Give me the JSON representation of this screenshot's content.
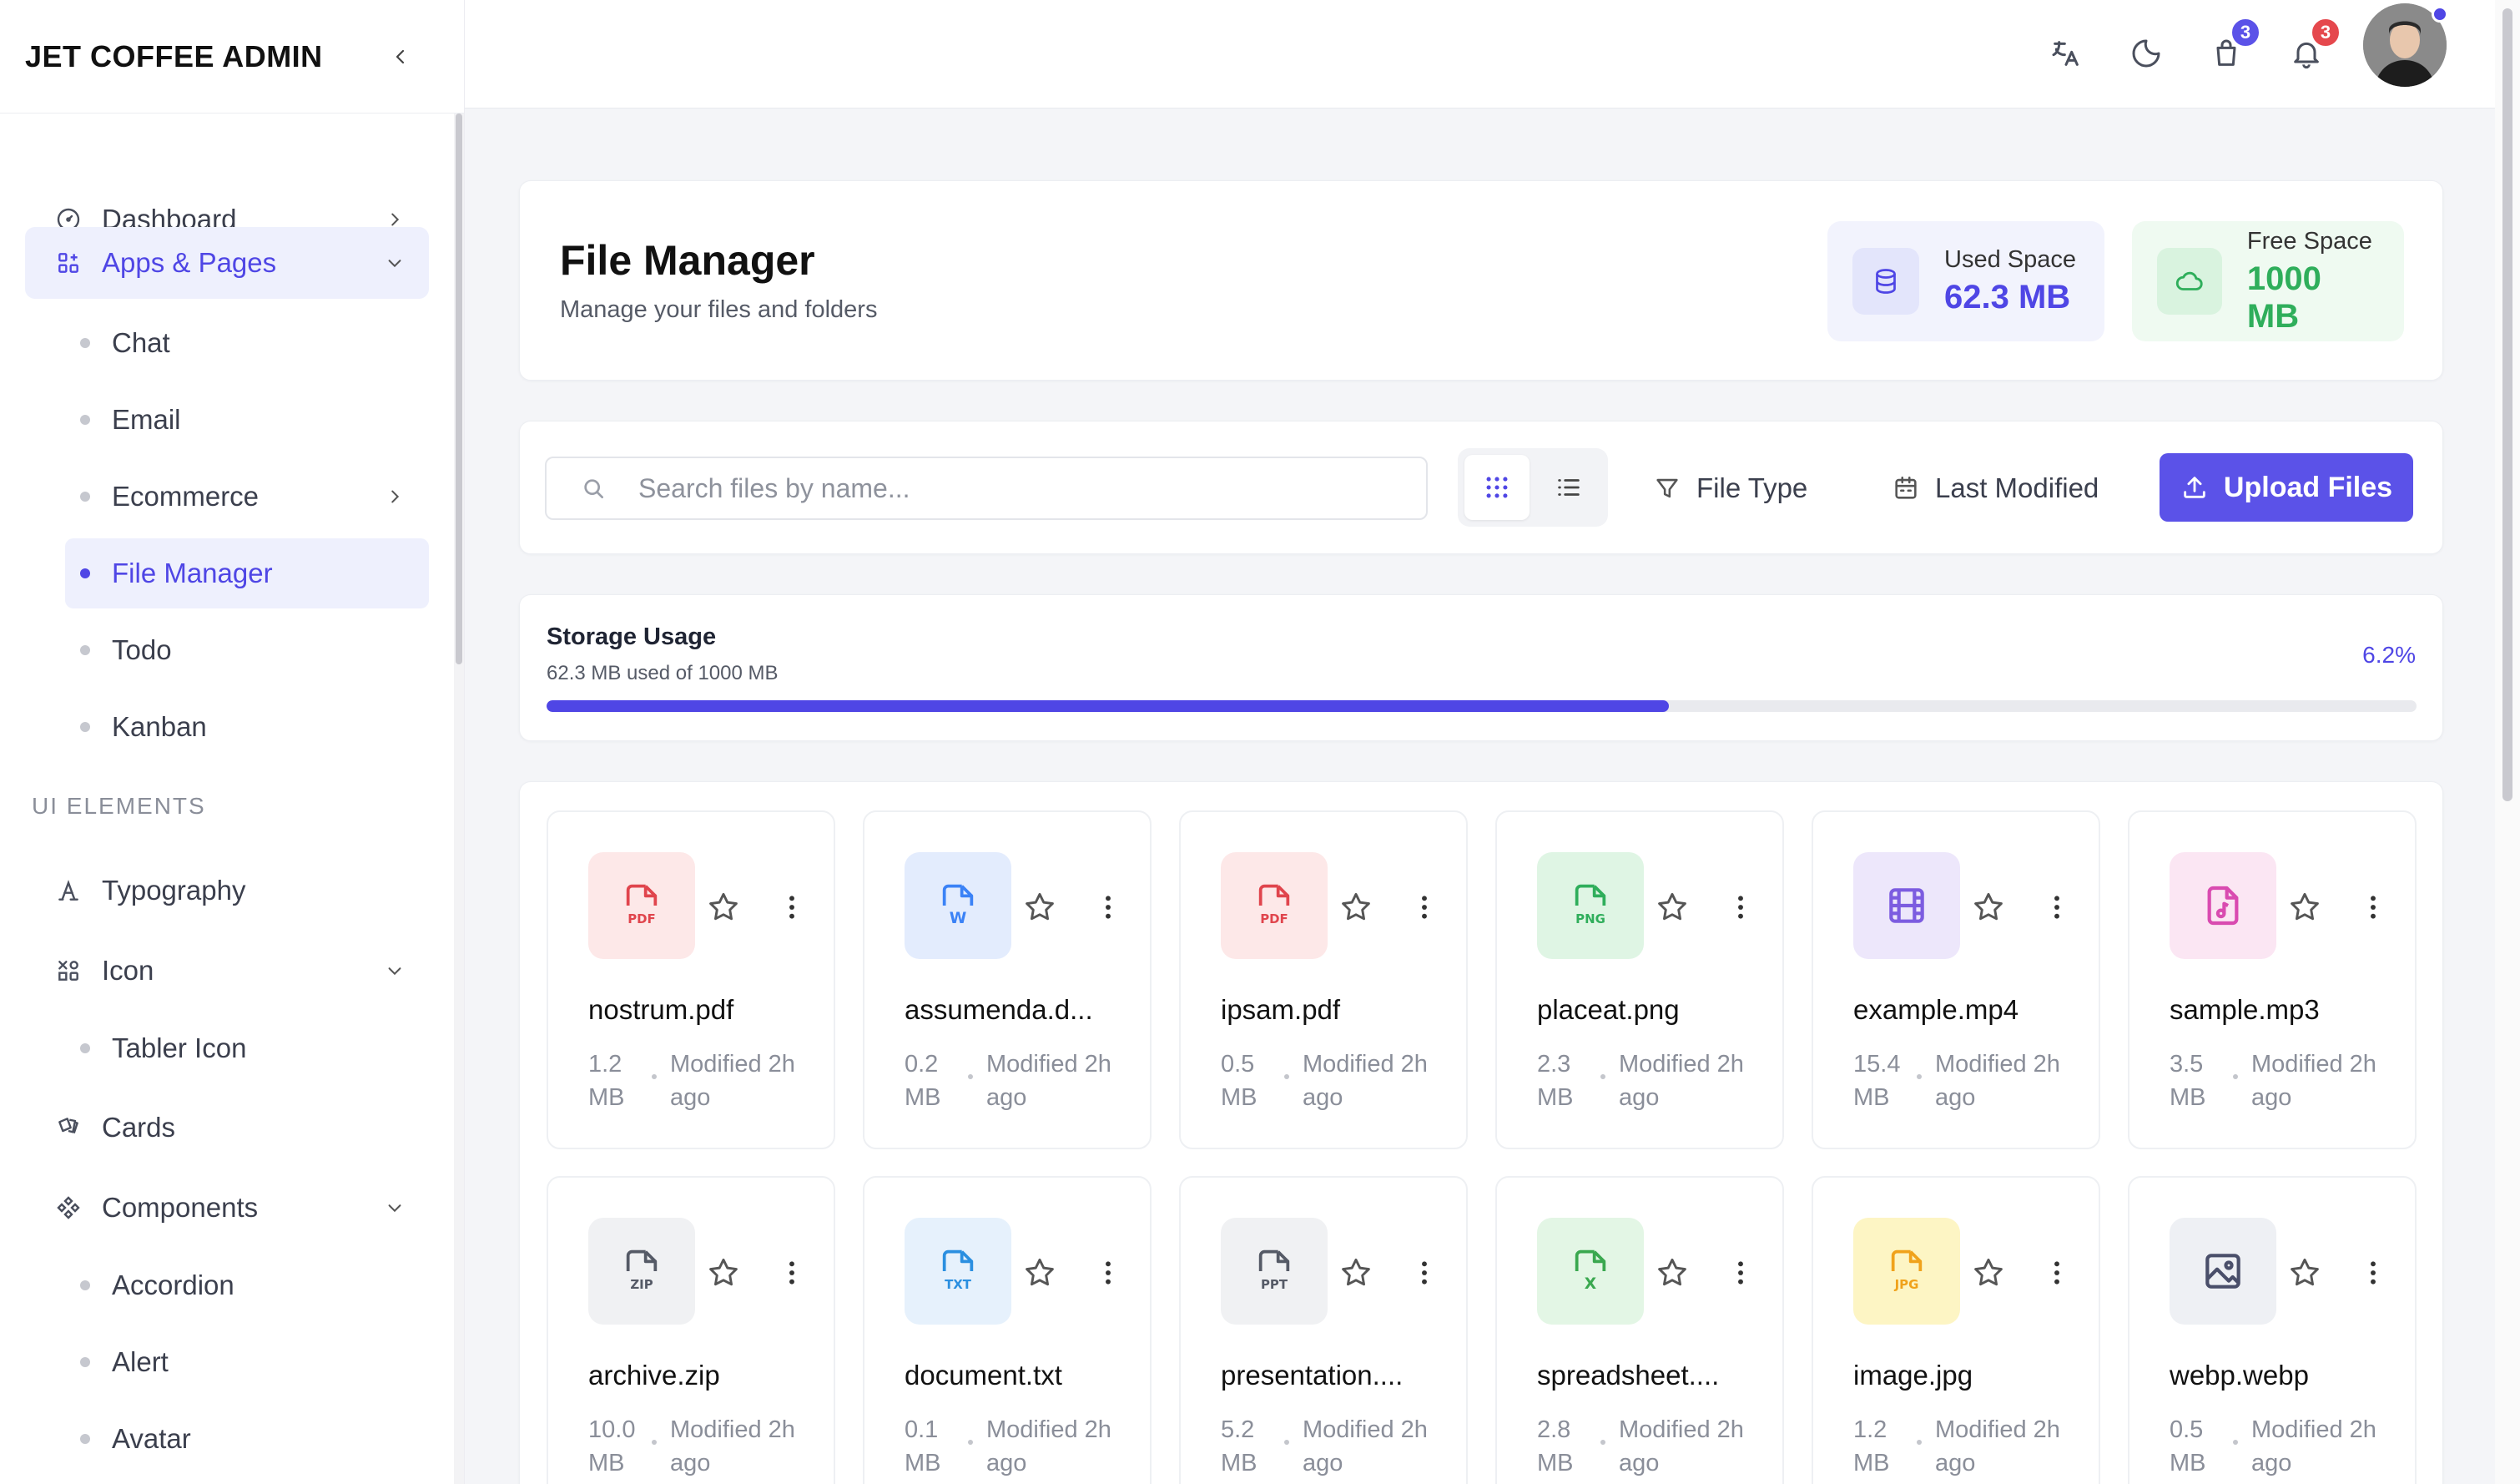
{
  "app": {
    "brand": "JET COFFEE ADMIN"
  },
  "sidebar": {
    "items": [
      {
        "label": "Dashboard"
      },
      {
        "label": "Apps & Pages"
      },
      {
        "label": "Chat"
      },
      {
        "label": "Email"
      },
      {
        "label": "Ecommerce"
      },
      {
        "label": "File Manager"
      },
      {
        "label": "Todo"
      },
      {
        "label": "Kanban"
      },
      {
        "label": "Typography"
      },
      {
        "label": "Icon"
      },
      {
        "label": "Tabler Icon"
      },
      {
        "label": "Cards"
      },
      {
        "label": "Components"
      },
      {
        "label": "Accordion"
      },
      {
        "label": "Alert"
      },
      {
        "label": "Avatar"
      }
    ],
    "section_ui": "UI ELEMENTS"
  },
  "header": {
    "cart_count": "3",
    "notif_count": "3"
  },
  "page": {
    "title": "File Manager",
    "subtitle": "Manage your files and folders",
    "used_label": "Used Space",
    "used_value": "62.3 MB",
    "free_label": "Free Space",
    "free_value": "1000 MB"
  },
  "toolbar": {
    "search_placeholder": "Search files by name...",
    "file_type": "File Type",
    "last_modified": "Last Modified",
    "upload": "Upload Files"
  },
  "storage": {
    "title": "Storage Usage",
    "detail": "62.3 MB used of 1000 MB",
    "percent_label": "6.2%",
    "fill_fraction": 0.6
  },
  "files": [
    {
      "name": "nostrum.pdf",
      "size": "1.2 MB",
      "modified": "Modified 2h ago",
      "kind": "PDF"
    },
    {
      "name": "assumenda.d...",
      "size": "0.2 MB",
      "modified": "Modified 2h ago",
      "kind": "W"
    },
    {
      "name": "ipsam.pdf",
      "size": "0.5 MB",
      "modified": "Modified 2h ago",
      "kind": "PDF"
    },
    {
      "name": "placeat.png",
      "size": "2.3 MB",
      "modified": "Modified 2h ago",
      "kind": "PNG"
    },
    {
      "name": "example.mp4",
      "size": "15.4 MB",
      "modified": "Modified 2h ago",
      "kind": "video"
    },
    {
      "name": "sample.mp3",
      "size": "3.5 MB",
      "modified": "Modified 2h ago",
      "kind": "audio"
    },
    {
      "name": "archive.zip",
      "size": "10.0 MB",
      "modified": "Modified 2h ago",
      "kind": "ZIP"
    },
    {
      "name": "document.txt",
      "size": "0.1 MB",
      "modified": "Modified 2h ago",
      "kind": "TXT"
    },
    {
      "name": "presentation....",
      "size": "5.2 MB",
      "modified": "Modified 2h ago",
      "kind": "PPT"
    },
    {
      "name": "spreadsheet....",
      "size": "2.8 MB",
      "modified": "Modified 2h ago",
      "kind": "X"
    },
    {
      "name": "image.jpg",
      "size": "1.2 MB",
      "modified": "Modified 2h ago",
      "kind": "JPG"
    },
    {
      "name": "webp.webp",
      "size": "0.5 MB",
      "modified": "Modified 2h ago",
      "kind": "image"
    }
  ],
  "colors": {
    "accent": "#4f46e5",
    "pdf": "#e0454d",
    "word": "#3b82f6",
    "png": "#2fae5b",
    "video": "#7c5ce0",
    "audio": "#d94bb0",
    "zip": "#555a66",
    "txt": "#2b8fe0",
    "ppt": "#555a66",
    "xls": "#3aa84f",
    "jpg": "#f0a21b",
    "img": "#4a4f6a"
  }
}
